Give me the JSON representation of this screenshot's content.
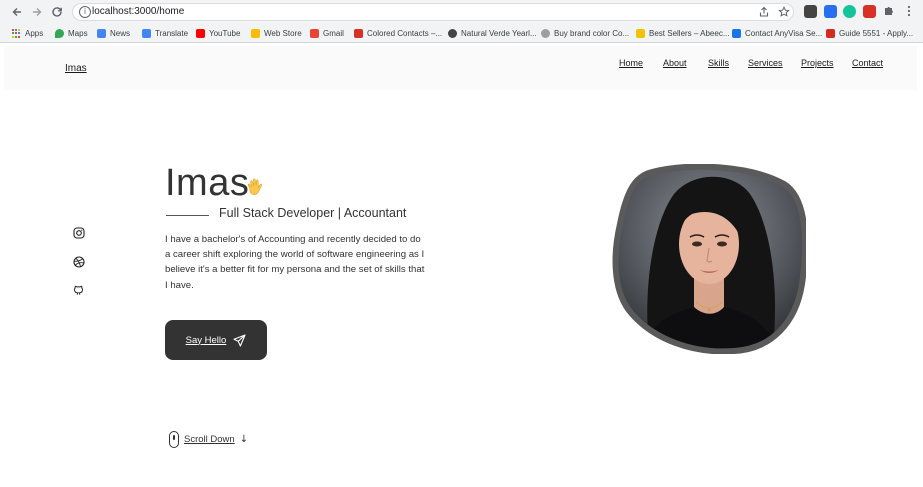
{
  "browser": {
    "url": "localhost:3000/home",
    "bookmarks": [
      {
        "label": "Apps"
      },
      {
        "label": "Maps"
      },
      {
        "label": "News"
      },
      {
        "label": "Translate"
      },
      {
        "label": "YouTube"
      },
      {
        "label": "Web Store"
      },
      {
        "label": "Gmail"
      },
      {
        "label": "Colored Contacts –..."
      },
      {
        "label": "Natural Verde Yearl..."
      },
      {
        "label": "Buy brand color Co..."
      },
      {
        "label": "Best Sellers – Abeec..."
      },
      {
        "label": "Contact AnyVisa Se..."
      },
      {
        "label": "Guide 5551 - Apply..."
      }
    ]
  },
  "header": {
    "logo": "Imas",
    "nav": [
      "Home",
      "About",
      "Skills",
      "Services",
      "Projects",
      "Contact"
    ]
  },
  "hero": {
    "name": "Imas",
    "subtitle": "Full Stack Developer | Accountant",
    "description": "I have a bachelor's of Accounting and recently decided to do a career shift exploring the world of software engineering as I believe it's a better fit for my persona and the set of skills that I have.",
    "cta_label": "Say Hello",
    "scroll_label": "Scroll Down",
    "social_icons": [
      "instagram-icon",
      "dribbble-icon",
      "github-icon"
    ]
  },
  "colors": {
    "text": "#333333",
    "button_bg": "#333333",
    "header_bg": "#fafafa",
    "photo_border": "#5a5a5a"
  }
}
